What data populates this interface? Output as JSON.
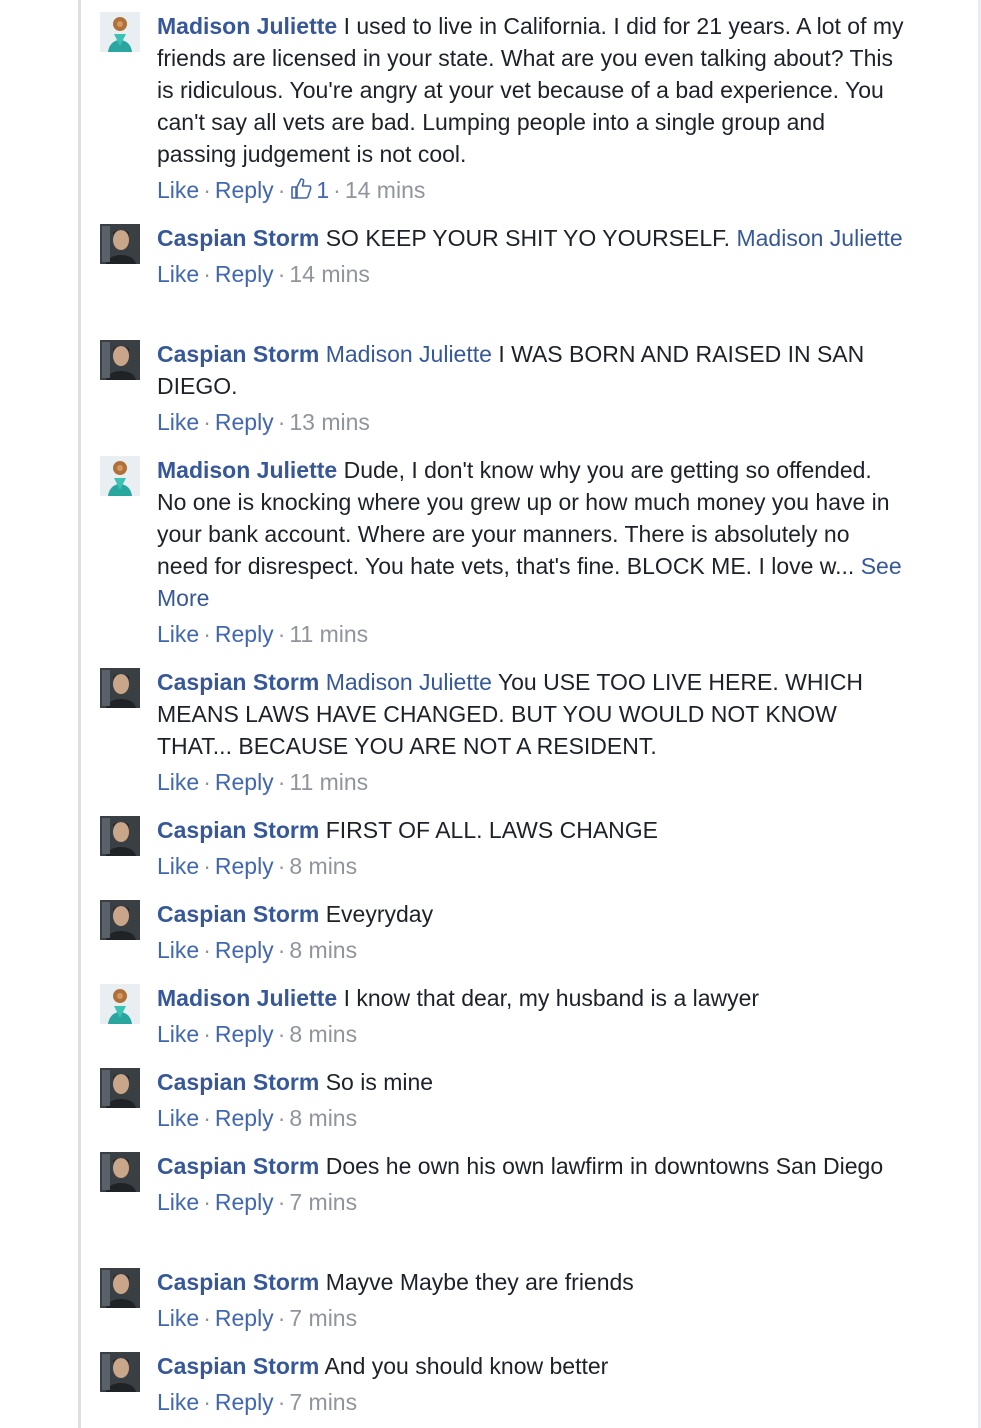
{
  "actions": {
    "like": "Like",
    "reply": "Reply",
    "separator": "·",
    "see_more": "See More"
  },
  "colors": {
    "link": "#365899",
    "action": "#4267b2",
    "meta": "#90949c",
    "text": "#1d2129"
  },
  "comments": [
    {
      "author": "Madison Juliette",
      "mention": "",
      "text": "I used to live in California. I did for 21 years. A lot of my friends are licensed in your state. What are you even talking about? This is ridiculous. You're angry at your vet because of a bad experience. You can't say all vets are bad. Lumping people into a single group and passing judgement is not cool.",
      "trailing_mention": "",
      "likes": "1",
      "time": "14 mins"
    },
    {
      "author": "Caspian Storm",
      "mention": "",
      "text": "SO KEEP YOUR SHIT YO YOURSELF.",
      "trailing_mention": "Madison Juliette",
      "likes": "",
      "time": "14 mins"
    },
    {
      "author": "Caspian Storm",
      "mention": "Madison Juliette",
      "text": "I WAS BORN AND RAISED IN SAN DIEGO.",
      "trailing_mention": "",
      "likes": "",
      "time": "13 mins"
    },
    {
      "author": "Madison Juliette",
      "mention": "",
      "text": "Dude, I don't know why you are getting so offended. No one is knocking where you grew up or how much money you have in your bank account. Where are your manners. There is absolutely no need for disrespect. You hate vets, that's fine. BLOCK ME. I love w...",
      "trailing_mention": "",
      "likes": "",
      "time": "11 mins",
      "see_more": true
    },
    {
      "author": "Caspian Storm",
      "mention": "Madison Juliette",
      "text": "You USE TOO LIVE HERE. WHICH MEANS LAWS HAVE CHANGED. BUT YOU WOULD NOT KNOW THAT... BECAUSE YOU ARE NOT A RESIDENT.",
      "trailing_mention": "",
      "likes": "",
      "time": "11 mins"
    },
    {
      "author": "Caspian Storm",
      "mention": "",
      "text": "FIRST OF ALL. LAWS CHANGE",
      "trailing_mention": "",
      "likes": "",
      "time": "8 mins"
    },
    {
      "author": "Caspian Storm",
      "mention": "",
      "text": "Eveyryday",
      "trailing_mention": "",
      "likes": "",
      "time": "8 mins"
    },
    {
      "author": "Madison Juliette",
      "mention": "",
      "text": "I know that dear, my husband is a lawyer",
      "trailing_mention": "",
      "likes": "",
      "time": "8 mins"
    },
    {
      "author": "Caspian Storm",
      "mention": "",
      "text": "So is mine",
      "trailing_mention": "",
      "likes": "",
      "time": "8 mins"
    },
    {
      "author": "Caspian Storm",
      "mention": "",
      "text": "Does he own his own lawfirm in downtowns San Diego",
      "trailing_mention": "",
      "likes": "",
      "time": "7 mins"
    },
    {
      "author": "Caspian Storm",
      "mention": "",
      "text": "Mayve Maybe they are friends",
      "trailing_mention": "",
      "likes": "",
      "time": "7 mins"
    },
    {
      "author": "Caspian Storm",
      "mention": "",
      "text": "And you should know better",
      "trailing_mention": "",
      "likes": "",
      "time": "7 mins"
    }
  ]
}
